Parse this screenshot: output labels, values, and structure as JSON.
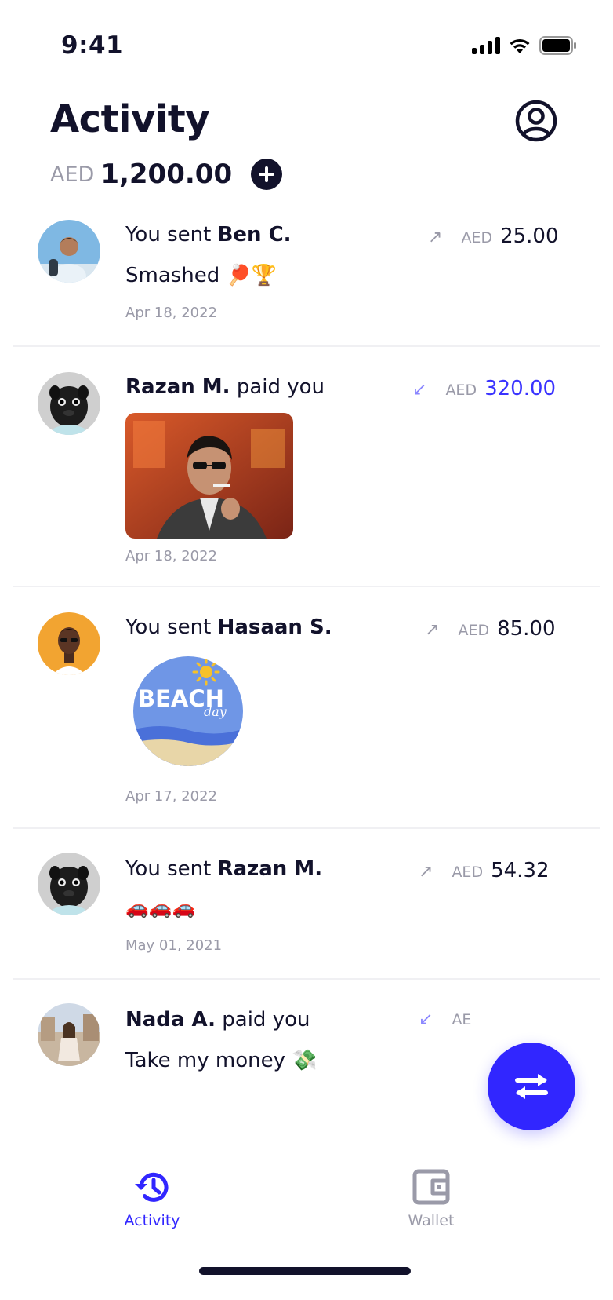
{
  "status_bar": {
    "time": "9:41"
  },
  "header": {
    "title": "Activity",
    "balance_currency": "AED",
    "balance_amount": "1,200.00"
  },
  "feed": [
    {
      "prefix": "You sent ",
      "name": "Ben C.",
      "suffix": "",
      "direction": "sent",
      "currency": "AED",
      "amount": "25.00",
      "note": "Smashed 🏓🏆",
      "date": "Apr 18, 2022",
      "attachment": "none"
    },
    {
      "prefix": "",
      "name": "Razan M.",
      "suffix": " paid you",
      "direction": "received",
      "currency": "AED",
      "amount": "320.00",
      "note": "",
      "date": "Apr 18, 2022",
      "attachment": "photo"
    },
    {
      "prefix": "You sent ",
      "name": "Hasaan S.",
      "suffix": "",
      "direction": "sent",
      "currency": "AED",
      "amount": "85.00",
      "note": "",
      "date": "Apr 17, 2022",
      "attachment": "sticker",
      "sticker_text": "BEACH",
      "sticker_sub": "day"
    },
    {
      "prefix": "You sent ",
      "name": "Razan M.",
      "suffix": "",
      "direction": "sent",
      "currency": "AED",
      "amount": "54.32",
      "note": "🚗🚗🚗",
      "date": "May 01, 2021",
      "attachment": "none"
    },
    {
      "prefix": "",
      "name": "Nada A.",
      "suffix": " paid you",
      "direction": "received",
      "currency": "AE",
      "amount": "",
      "note": "Take my money 💸",
      "date": "",
      "attachment": "none"
    }
  ],
  "tabs": [
    {
      "label": "Activity",
      "active": true,
      "icon": "history-icon"
    },
    {
      "label": "Wallet",
      "active": false,
      "icon": "wallet-icon"
    }
  ],
  "colors": {
    "accent": "#3126ff",
    "text": "#12122b",
    "muted": "#9a9aa8"
  }
}
